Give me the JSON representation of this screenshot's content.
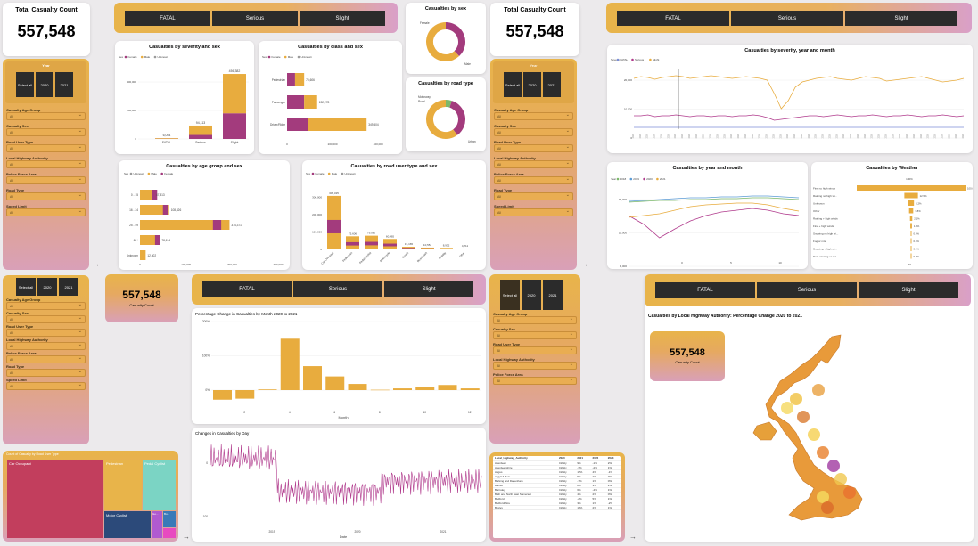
{
  "kpi": {
    "title": "Total Casualty Count",
    "value": "557,548",
    "subtitle": "Casualty Count"
  },
  "severity_buttons": [
    "FATAL",
    "Serious",
    "Slight"
  ],
  "years": {
    "label": "Year",
    "select_all": "Select all",
    "y1": "2020",
    "y2": "2021"
  },
  "filters": [
    "Casualty Age Group",
    "Casualty Sex",
    "Road User Type",
    "Local Highway Authority",
    "Police Force Area",
    "Road Type",
    "Speed Limit"
  ],
  "filter_value": "All",
  "colors": {
    "female": "#a33b7d",
    "male": "#e8ac3e",
    "unknown": "#9a9a9a",
    "fatal": "#7b8ed6",
    "serious": "#b03a8c",
    "slight": "#e8ac3e"
  },
  "legend": {
    "sex": "Sex",
    "female": "Female",
    "male": "Male",
    "unknown": "Unknown",
    "severity": "Severity",
    "fatal": "FATAL",
    "serious": "Serious",
    "slight": "Slight",
    "year": "Year"
  },
  "charts": {
    "sev_sex": {
      "title": "Casualties by severity and sex",
      "categories": [
        "FATAL",
        "Serious",
        "Slight"
      ],
      "labels": [
        "6,054",
        "94,113",
        "456,382"
      ],
      "female": [
        1500,
        28000,
        180000
      ],
      "male": [
        4500,
        66000,
        276000
      ],
      "ticks": [
        "0",
        "200,000",
        "400,000"
      ]
    },
    "class_sex": {
      "title": "Casualties by class and sex",
      "categories": [
        "Pedestrian",
        "Passenger",
        "Driver/Rider"
      ],
      "labels": [
        "75,606",
        "132,278",
        "349,404"
      ],
      "female": [
        35000,
        75000,
        90000
      ],
      "male": [
        40000,
        57000,
        259000
      ],
      "ticks": [
        "0",
        "200,000",
        "400,000"
      ]
    },
    "sex_donut": {
      "title": "Casualties by sex",
      "labels": [
        "Female",
        "Male"
      ],
      "values": [
        38,
        62
      ]
    },
    "type_donut": {
      "title": "Casualties by road type",
      "labels": [
        "Motorway",
        "Rural",
        "Urban"
      ],
      "values": [
        5,
        35,
        60
      ]
    },
    "age_sex": {
      "title": "Casualties by age group and sex",
      "categories": [
        "0 - 15",
        "16 - 24",
        "25 - 59",
        "60+",
        "Unknown"
      ],
      "labels": [
        "47,813",
        "108,326",
        "314,371",
        "78,194",
        "12,302"
      ],
      "female": [
        17000,
        45000,
        120000,
        35000,
        0
      ],
      "male": [
        30813,
        63326,
        194371,
        43194,
        12302
      ],
      "ticks": [
        "0",
        "100,000",
        "200,000",
        "300,000"
      ]
    },
    "road_user": {
      "title": "Casualties by road user type and sex",
      "categories": [
        "Car Occupant",
        "Pedestrian",
        "Pedal Cyclist",
        "Motorcycle",
        "Goods",
        "Bus/Coach",
        "Mobility",
        "Other"
      ],
      "labels": [
        "309,325",
        "75,606",
        "79,082",
        "60,465",
        "15,165",
        "10,554",
        "8,932",
        "4,711"
      ],
      "values": [
        309325,
        75606,
        79082,
        60465,
        15165,
        10554,
        8932,
        4711
      ],
      "ticks": [
        "0",
        "100,000",
        "200,000",
        "300,000"
      ]
    },
    "sev_year_month": {
      "title": "Casualties by severity, year and month",
      "ticks": [
        "20,000",
        "10,000",
        "0"
      ]
    },
    "year_month": {
      "title": "Casualties by year and month",
      "ticks": [
        "15,000",
        "10,000",
        "5,000"
      ],
      "xticks": [
        "0",
        "5",
        "10"
      ]
    },
    "weather": {
      "title": "Casualties by Weather",
      "top_label": "100%",
      "bottom_label": "0%",
      "categories": [
        "Fine no high winds",
        "Raining no high wi...",
        "Unknown",
        "Other",
        "Raining + high winds",
        "Fine + high winds",
        "Snowing no high wi...",
        "Fog or mist",
        "Snowing + high wi...",
        "Data missing or out..."
      ],
      "labels": [
        "100.00%",
        "12.5%",
        "5.2%",
        "3.8%",
        "2.1%",
        "1.5%",
        "0.6%",
        "0.4%",
        "0.1%",
        "0.0%"
      ],
      "values": [
        100,
        12.5,
        5.2,
        3.8,
        2.1,
        1.5,
        0.6,
        0.4,
        0.1,
        0.02
      ]
    },
    "pct_change": {
      "title": "Percentage Change in Casualties by Month 2020 to 2021",
      "xlabel": "Month",
      "ticks": [
        "200%",
        "100%",
        "0%"
      ],
      "xticks": [
        "2",
        "4",
        "6",
        "8",
        "10",
        "12"
      ],
      "values": [
        -28,
        -25,
        2,
        150,
        70,
        40,
        18,
        1,
        5,
        10,
        15,
        5
      ]
    },
    "day_change": {
      "title": "Changes in Casualties by Day",
      "xlabel": "Date",
      "ticks": [
        "0",
        "-100"
      ],
      "xticks": [
        "2019",
        "2020",
        "2021"
      ]
    },
    "treemap": {
      "title": "Count of Casualty by Road User Type",
      "cells": [
        "Car Occupant",
        "Pedestrian",
        "Pedal Cyclist",
        "Motor Cyclist",
        "Go...",
        "Bu..."
      ]
    },
    "map": {
      "title": "Casualties by Local Highway Authority: Percentage Change 2020 to 2021"
    },
    "lha_table": {
      "headers": [
        "Local_Highway_Authority",
        "2020",
        "2021",
        "2022",
        "2023"
      ],
      "rows": [
        [
          "Aberdeen",
          "Infinity",
          "9%",
          "-1%",
          "2%"
        ],
        [
          "Aberdeenshire",
          "Infinity",
          "-3%",
          "-2%",
          "1%"
        ],
        [
          "Angus",
          "Infinity",
          "12%",
          "4%",
          "-1%"
        ],
        [
          "Argyll & Bute",
          "Infinity",
          "5%",
          "2%",
          "3%"
        ],
        [
          "Barking and Dagenham",
          "Infinity",
          "-7%",
          "1%",
          "0%"
        ],
        [
          "Barnet",
          "Infinity",
          "8%",
          "3%",
          "2%"
        ],
        [
          "Barnsley",
          "Infinity",
          "6%",
          "-4%",
          "1%"
        ],
        [
          "Bath and North East Somerset",
          "Infinity",
          "4%",
          "2%",
          "0%"
        ],
        [
          "Bedford",
          "Infinity",
          "-2%",
          "5%",
          "1%"
        ],
        [
          "Bedfordshire",
          "Infinity",
          "3%",
          "1%",
          "-2%"
        ],
        [
          "Bexley",
          "Infinity",
          "10%",
          "2%",
          "1%"
        ]
      ]
    }
  }
}
